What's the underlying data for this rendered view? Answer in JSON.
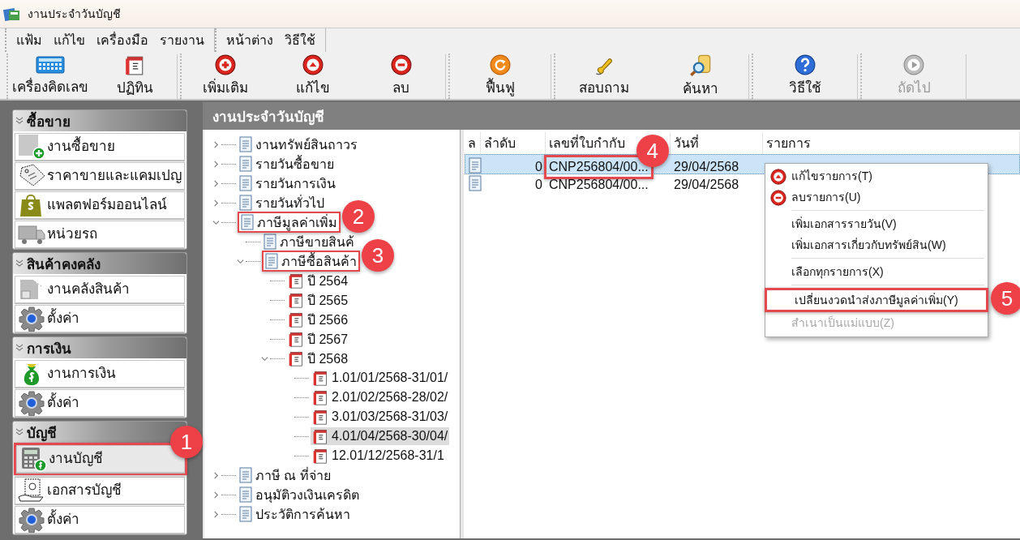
{
  "window": {
    "title": "งานประจำวันบัญชี"
  },
  "menu_bar": [
    [
      "แฟ้ม",
      "แก้ไข",
      "เครื่องมือ",
      "รายงาน"
    ],
    [
      "หน้าต่าง",
      "วิธีใช้"
    ]
  ],
  "toolbar": [
    {
      "buttons": [
        {
          "label": "เครื่องคิดเลข",
          "disabled": false
        },
        {
          "label": "ปฏิทิน",
          "disabled": false
        }
      ]
    },
    {
      "buttons": [
        {
          "label": "เพิ่มเติม",
          "disabled": false
        },
        {
          "label": "แก้ไข",
          "disabled": false
        },
        {
          "label": "ลบ",
          "disabled": false
        }
      ]
    },
    {
      "buttons": [
        {
          "label": "ฟื้นฟู",
          "disabled": false
        }
      ]
    },
    {
      "buttons": [
        {
          "label": "สอบถาม",
          "disabled": false
        },
        {
          "label": "ค้นหา",
          "disabled": false
        }
      ]
    },
    {
      "buttons": [
        {
          "label": "วิธีใช้",
          "disabled": false
        }
      ]
    },
    {
      "buttons": [
        {
          "label": "ถัดไป",
          "disabled": true
        }
      ]
    }
  ],
  "sidebar": [
    {
      "title": "ซื้อขาย",
      "items": [
        {
          "label": "งานซื้อขาย",
          "selected": false
        },
        {
          "label": "ราคาขายและแคมเปญ",
          "selected": false
        },
        {
          "label": "แพลตฟอร์มออนไลน์",
          "selected": false
        },
        {
          "label": "หน่วยรถ",
          "selected": false
        }
      ]
    },
    {
      "title": "สินค้าคงคลัง",
      "items": [
        {
          "label": "งานคลังสินค้า",
          "selected": false
        },
        {
          "label": "ตั้งค่า",
          "selected": false
        }
      ]
    },
    {
      "title": "การเงิน",
      "items": [
        {
          "label": "งานการเงิน",
          "selected": false
        },
        {
          "label": "ตั้งค่า",
          "selected": false
        }
      ]
    },
    {
      "title": "บัญชี",
      "items": [
        {
          "label": "งานบัญชี",
          "selected": true,
          "annotation": "1"
        },
        {
          "label": "เอกสารบัญชี",
          "selected": false
        },
        {
          "label": "ตั้งค่า",
          "selected": false
        }
      ]
    }
  ],
  "panel": {
    "title": "งานประจำวันบัญชี"
  },
  "tree": [
    {
      "label": "งานทรัพย์สินถาวร",
      "expanded": false,
      "selected": false
    },
    {
      "label": "รายวันซื้อขาย",
      "expanded": false,
      "selected": false
    },
    {
      "label": "รายวันการเงิน",
      "expanded": false,
      "selected": false
    },
    {
      "label": "รายวันทั่วไป",
      "expanded": false,
      "selected": false
    },
    {
      "label": "ภาษีมูลค่าเพิ่ม",
      "expanded": true,
      "selected": false,
      "annotation": "2",
      "children": [
        {
          "label": "ภาษีขายสินค้",
          "selected": false
        },
        {
          "label": "ภาษีซื้อสินค้า",
          "expanded": true,
          "selected": false,
          "annotation": "3",
          "children": [
            {
              "label": "ปี 2564",
              "selected": false
            },
            {
              "label": "ปี 2565",
              "selected": false
            },
            {
              "label": "ปี 2566",
              "selected": false
            },
            {
              "label": "ปี 2567",
              "selected": false
            },
            {
              "label": "ปี 2568",
              "expanded": true,
              "selected": false,
              "children": [
                {
                  "label": "1.01/01/2568-31/01/",
                  "selected": false
                },
                {
                  "label": "2.01/02/2568-28/02/",
                  "selected": false
                },
                {
                  "label": "3.01/03/2568-31/03/",
                  "selected": false
                },
                {
                  "label": "4.01/04/2568-30/04/",
                  "selected": true
                },
                {
                  "label": "12.01/12/2568-31/1",
                  "selected": false
                }
              ]
            }
          ]
        }
      ]
    },
    {
      "label": "ภาษี ณ ที่จ่าย",
      "expanded": false,
      "selected": false
    },
    {
      "label": "อนุมัติวงเงินเครดิต",
      "expanded": false,
      "selected": false
    },
    {
      "label": "ประวัติการค้นหา",
      "expanded": false,
      "selected": false
    }
  ],
  "table": {
    "columns": [
      "ล",
      "ลำดับ",
      "เลขที่ใบกำกับ",
      "วันที่",
      "รายการ"
    ],
    "rows": [
      {
        "selected": true,
        "cells": [
          {
            "kind": "icon"
          },
          {
            "kind": "text",
            "text": "0"
          },
          {
            "kind": "text",
            "text": "CNP256804/00...",
            "annotation": "4"
          },
          {
            "kind": "text",
            "text": "29/04/2568"
          }
        ]
      },
      {
        "selected": false,
        "cells": [
          {
            "kind": "icon"
          },
          {
            "kind": "text",
            "text": "0"
          },
          {
            "kind": "text",
            "text": "CNP256804/00..."
          },
          {
            "kind": "text",
            "text": "29/04/2568"
          }
        ]
      }
    ]
  },
  "context_menu": {
    "items": [
      {
        "kind": "item",
        "label": "แก้ไขรายการ(T)",
        "disabled": false
      },
      {
        "kind": "item",
        "label": "ลบรายการ(U)",
        "disabled": false
      },
      {
        "kind": "separator"
      },
      {
        "kind": "item",
        "label": "เพิ่มเอกสารรายวัน(V)",
        "disabled": false
      },
      {
        "kind": "item",
        "label": "เพิ่มเอกสารเกี่ยวกับทรัพย์สิน(W)",
        "disabled": false
      },
      {
        "kind": "separator"
      },
      {
        "kind": "item",
        "label": "เลือกทุกรายการ(X)",
        "disabled": false
      },
      {
        "kind": "separator"
      },
      {
        "kind": "item",
        "label": "เปลี่ยนงวดนำส่งภาษีมูลค่าเพิ่ม(Y)",
        "disabled": false,
        "annotation": "5"
      },
      {
        "kind": "item",
        "label": "สำเนาเป็นแม่แบบ(Z)",
        "disabled": true
      }
    ]
  }
}
